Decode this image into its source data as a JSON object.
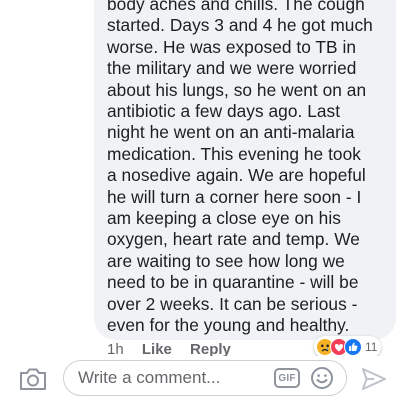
{
  "comment": {
    "lines": [
      "body aches and chills. The cough",
      "started. Days 3 and 4 he got much",
      "worse. He was exposed to TB in",
      "the military and we were worried",
      "about his lungs, so he went on an",
      "antibiotic a few days ago. Last",
      "night he went on an anti-malaria",
      "medication. This evening he took",
      "a nosedive again. We are hopeful",
      "he will turn a corner here soon - I",
      "am keeping a close eye on his",
      "oxygen, heart rate and temp. We",
      "are waiting to see how long we",
      "need to be in quarantine - will be",
      "over 2 weeks. It can be serious -",
      "even for the young and healthy."
    ]
  },
  "meta": {
    "time": "1h",
    "like_label": "Like",
    "reply_label": "Reply"
  },
  "reactions": {
    "icons": [
      "sad-icon",
      "love-icon",
      "like-icon"
    ],
    "count": "11"
  },
  "composer": {
    "placeholder": "Write a comment...",
    "gif_label": "GIF",
    "camera_icon": "camera-icon",
    "emoji_icon": "smiley-icon",
    "send_icon": "send-icon"
  },
  "colors": {
    "bubble": "#f0f2f5",
    "text": "#1c1e21",
    "secondary": "#65676b",
    "love": "#f33e58",
    "like": "#1877f2",
    "sad": "#f7b125"
  }
}
